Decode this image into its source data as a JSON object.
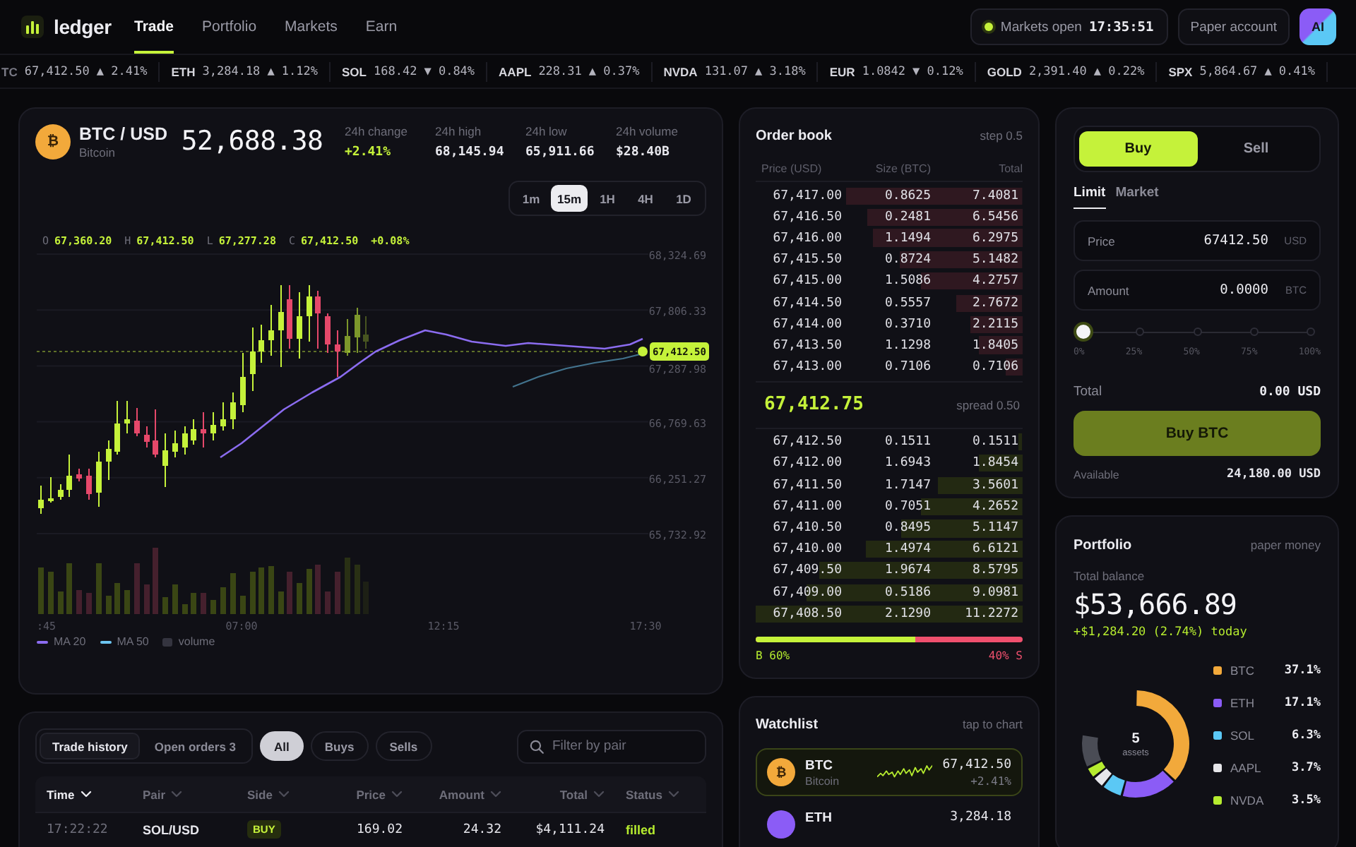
{
  "nav": {
    "logo": "ledger",
    "tabs": [
      {
        "label": "Trade",
        "selected": true
      },
      {
        "label": "Portfolio",
        "selected": false
      },
      {
        "label": "Markets",
        "selected": false
      },
      {
        "label": "Earn",
        "selected": false
      }
    ],
    "market_status": {
      "label": "Markets open",
      "time": "17:35:51",
      "open": true
    },
    "account_button": "Paper account",
    "avatar": "AI"
  },
  "ticker": [
    {
      "symbol": "TC",
      "price": "67,412.50",
      "change": "▲ 2.41%"
    },
    {
      "symbol": "ETH",
      "price": "3,284.18",
      "change": "▲ 1.12%"
    },
    {
      "symbol": "SOL",
      "price": "168.42",
      "change": "▼ 0.84%"
    },
    {
      "symbol": "AAPL",
      "price": "228.31",
      "change": "▲ 0.37%"
    },
    {
      "symbol": "NVDA",
      "price": "131.07",
      "change": "▲ 3.18%"
    },
    {
      "symbol": "EUR",
      "price": "1.0842",
      "change": "▼ 0.12%"
    },
    {
      "symbol": "GOLD",
      "price": "2,391.40",
      "change": "▲ 0.22%"
    },
    {
      "symbol": "SPX",
      "price": "5,864.67",
      "change": "▲ 0.41%"
    }
  ],
  "chart_panel": {
    "coin": {
      "glyph": "₿",
      "pair": "BTC / USD",
      "name": "Bitcoin",
      "color": "#f2a93b"
    },
    "price": "52,688.38",
    "stats": [
      {
        "label": "24h change",
        "value": "+2.41%",
        "kind": "up"
      },
      {
        "label": "24h high",
        "value": "68,145.94",
        "kind": "plain"
      },
      {
        "label": "24h low",
        "value": "65,911.66",
        "kind": "plain"
      },
      {
        "label": "24h volume",
        "value": "$28.40B",
        "kind": "plain"
      }
    ],
    "intervals": [
      {
        "label": "1m",
        "selected": false
      },
      {
        "label": "15m",
        "selected": true
      },
      {
        "label": "1H",
        "selected": false
      },
      {
        "label": "4H",
        "selected": false
      },
      {
        "label": "1D",
        "selected": false
      }
    ],
    "ohlc": [
      {
        "key": "O",
        "value": "67,360.20"
      },
      {
        "key": "H",
        "value": "67,412.50"
      },
      {
        "key": "L",
        "value": "67,277.28"
      },
      {
        "key": "C",
        "value": "67,412.50"
      }
    ],
    "ohlc_change": "+0.08%",
    "y_axis_labels": [
      "68,324.69",
      "67,806.33",
      "67,287.98",
      "66,769.63",
      "66,251.27",
      "65,732.92"
    ],
    "price_tag": "67,412.50",
    "x_axis_labels": [
      ":45",
      "07:00",
      "12:15",
      "17:30"
    ],
    "legend": [
      {
        "label": "MA 20",
        "kind": "line",
        "color": "#8b6cf0"
      },
      {
        "label": "MA 50",
        "kind": "line",
        "color": "#6cc4f0"
      },
      {
        "label": "volume",
        "kind": "swatch",
        "color": "#34343f"
      }
    ]
  },
  "order_book": {
    "title": "Order book",
    "step": "step 0.5",
    "columns": [
      "Price (USD)",
      "Size (BTC)",
      "Total"
    ],
    "asks": [
      {
        "price": "67,417.00",
        "size": "0.8625",
        "total": "7.4081"
      },
      {
        "price": "67,416.50",
        "size": "0.2481",
        "total": "6.5456"
      },
      {
        "price": "67,416.00",
        "size": "1.1494",
        "total": "6.2975"
      },
      {
        "price": "67,415.50",
        "size": "0.8724",
        "total": "5.1482"
      },
      {
        "price": "67,415.00",
        "size": "1.5086",
        "total": "4.2757"
      },
      {
        "price": "67,414.50",
        "size": "0.5557",
        "total": "2.7672"
      },
      {
        "price": "67,414.00",
        "size": "0.3710",
        "total": "2.2115"
      },
      {
        "price": "67,413.50",
        "size": "1.1298",
        "total": "1.8405"
      },
      {
        "price": "67,413.00",
        "size": "0.7106",
        "total": "0.7106"
      }
    ],
    "mid_price": "67,412.75",
    "spread": "spread 0.50",
    "bids": [
      {
        "price": "67,412.50",
        "size": "0.1511",
        "total": "0.1511"
      },
      {
        "price": "67,412.00",
        "size": "1.6943",
        "total": "1.8454"
      },
      {
        "price": "67,411.50",
        "size": "1.7147",
        "total": "3.5601"
      },
      {
        "price": "67,411.00",
        "size": "0.7051",
        "total": "4.2652"
      },
      {
        "price": "67,410.50",
        "size": "0.8495",
        "total": "5.1147"
      },
      {
        "price": "67,410.00",
        "size": "1.4974",
        "total": "6.6121"
      },
      {
        "price": "67,409.50",
        "size": "1.9674",
        "total": "8.5795"
      },
      {
        "price": "67,409.00",
        "size": "0.5186",
        "total": "9.0981"
      },
      {
        "price": "67,408.50",
        "size": "2.1290",
        "total": "11.2272"
      }
    ],
    "ratio": {
      "buy_label": "B 60%",
      "sell_label": "40% S",
      "level": 0.6
    }
  },
  "order_form": {
    "sides": [
      {
        "label": "Buy",
        "selected": true
      },
      {
        "label": "Sell",
        "selected": false
      }
    ],
    "types": [
      {
        "label": "Limit",
        "selected": true
      },
      {
        "label": "Market",
        "selected": false
      }
    ],
    "fields": [
      {
        "label": "Price",
        "value": "67412.50",
        "unit": "USD"
      },
      {
        "label": "Amount",
        "value": "0.0000",
        "unit": "BTC"
      }
    ],
    "slider": {
      "level": 0,
      "stops": [
        "0%",
        "25%",
        "50%",
        "75%",
        "100%"
      ]
    },
    "total_label": "Total",
    "total_value": "0.00 USD",
    "submit": "Buy BTC",
    "available_label": "Available",
    "available_value": "24,180.00 USD"
  },
  "portfolio": {
    "title": "Portfolio",
    "note": "paper money",
    "balance_label": "Total balance",
    "balance": "$53,666.89",
    "change": "+$1,284.20 (2.74%) today",
    "donut_count": "5",
    "donut_caption": "assets",
    "allocation": [
      {
        "asset": "BTC",
        "share": "37.1%",
        "color": "#f2a93b"
      },
      {
        "asset": "ETH",
        "share": "17.1%",
        "color": "#8b5cf6"
      },
      {
        "asset": "SOL",
        "share": "6.3%",
        "color": "#5bc8f5"
      },
      {
        "asset": "AAPL",
        "share": "3.7%",
        "color": "#e6e6ea"
      },
      {
        "asset": "NVDA",
        "share": "3.5%",
        "color": "#b6ec2f"
      }
    ]
  },
  "watchlist": {
    "title": "Watchlist",
    "hint": "tap to chart",
    "items": [
      {
        "symbol": "BTC",
        "name": "Bitcoin",
        "glyph": "₿",
        "price": "67,412.50",
        "change": "+2.41%",
        "color": "#f2a93b",
        "selected": true
      },
      {
        "symbol": "ETH",
        "price": "3,284.18",
        "color": "#8b5cf6",
        "selected": false
      }
    ]
  },
  "trades": {
    "tabs": [
      {
        "label": "Trade history",
        "selected": true
      },
      {
        "label": "Open orders 3",
        "selected": false
      }
    ],
    "filters": [
      {
        "label": "All",
        "selected": true
      },
      {
        "label": "Buys",
        "selected": false
      },
      {
        "label": "Sells",
        "selected": false
      }
    ],
    "search": {
      "placeholder": "Filter by pair"
    },
    "columns": [
      {
        "label": "Time",
        "sorted": true
      },
      {
        "label": "Pair",
        "sorted": false
      },
      {
        "label": "Side",
        "sorted": false
      },
      {
        "label": "Price",
        "sorted": false
      },
      {
        "label": "Amount",
        "sorted": false
      },
      {
        "label": "Total",
        "sorted": false
      },
      {
        "label": "Status",
        "sorted": false
      }
    ],
    "rows": [
      {
        "time": "17:22:22",
        "pair": "SOL/USD",
        "side": "BUY",
        "kind": "buy",
        "price": "169.02",
        "amount": "24.32",
        "total": "$4,111.24",
        "status": "filled",
        "complete": true
      }
    ]
  }
}
